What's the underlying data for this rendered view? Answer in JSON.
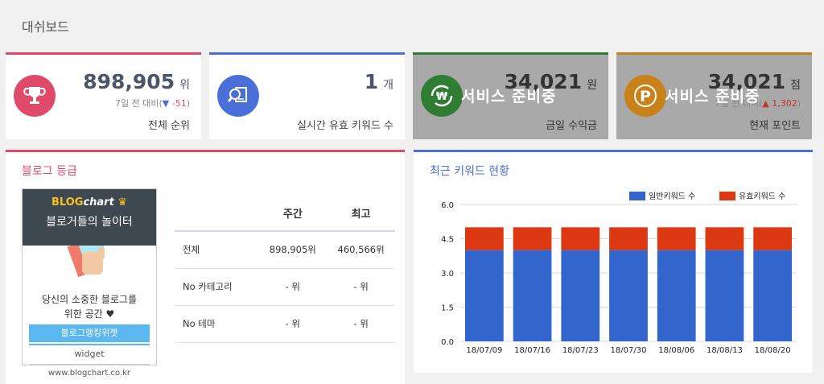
{
  "page_title": "대쉬보드",
  "cards": [
    {
      "value": "898,905",
      "unit": "위",
      "sub_prefix": "7일 전 대비(",
      "sub_arrow": "▼",
      "sub_change": "-51",
      "sub_suffix": ")",
      "label": "전체 순위",
      "accent": "#e04a6a",
      "icon": "trophy-icon"
    },
    {
      "value": "1",
      "unit": "개",
      "label": "실시간 유효 키워드 수",
      "accent": "#4a6fd8",
      "icon": "search-document-icon"
    },
    {
      "value": "34,021",
      "unit": "원",
      "label": "금일 수익금",
      "overlay": "서비스 준비중",
      "accent": "#2e7d32",
      "icon": "won-coin-icon"
    },
    {
      "value": "34,021",
      "unit": "점",
      "sub_prefix": "7일 전 대비(",
      "sub_arrow": "▲",
      "sub_change": "1,302",
      "sub_suffix": ")",
      "label": "현재 포인트",
      "overlay": "서비스 준비중",
      "accent": "#c9811a",
      "icon": "point-coin-icon"
    }
  ],
  "blog_grade": {
    "title": "블로그 등급",
    "widget": {
      "brand_a": "BLOG",
      "brand_b": "chart",
      "tagline": "블로거들의 놀이터",
      "text1": "당신의 소중한 블로그를",
      "text2": "위한 공간 ♥",
      "button": "블로그랭킹위젯",
      "sub": "widget",
      "url": "www.blogchart.co.kr"
    },
    "table": {
      "headers": [
        "",
        "주간",
        "최고"
      ],
      "rows": [
        {
          "label": "전체",
          "weekly": "898,905위",
          "best": "460,566위"
        },
        {
          "label": "No 카테고리",
          "weekly": "- 위",
          "best": "- 위"
        },
        {
          "label": "No 테마",
          "weekly": "- 위",
          "best": "- 위"
        }
      ]
    }
  },
  "keyword_panel": {
    "title": "최근 키워드 현황"
  },
  "chart_data": {
    "type": "bar",
    "stacked": true,
    "categories": [
      "18/07/09",
      "18/07/16",
      "18/07/23",
      "18/07/30",
      "18/08/06",
      "18/08/13",
      "18/08/20"
    ],
    "series": [
      {
        "name": "일반키워드 수",
        "color": "#3366cc",
        "values": [
          4,
          4,
          4,
          4,
          4,
          4,
          4
        ]
      },
      {
        "name": "유효키워드 수",
        "color": "#dc3912",
        "values": [
          1,
          1,
          1,
          1,
          1,
          1,
          1
        ]
      }
    ],
    "ylim": [
      0,
      6
    ],
    "yticks": [
      "0.0",
      "1.5",
      "3.0",
      "4.5",
      "6.0"
    ],
    "legend": "top-right",
    "grid": true
  }
}
